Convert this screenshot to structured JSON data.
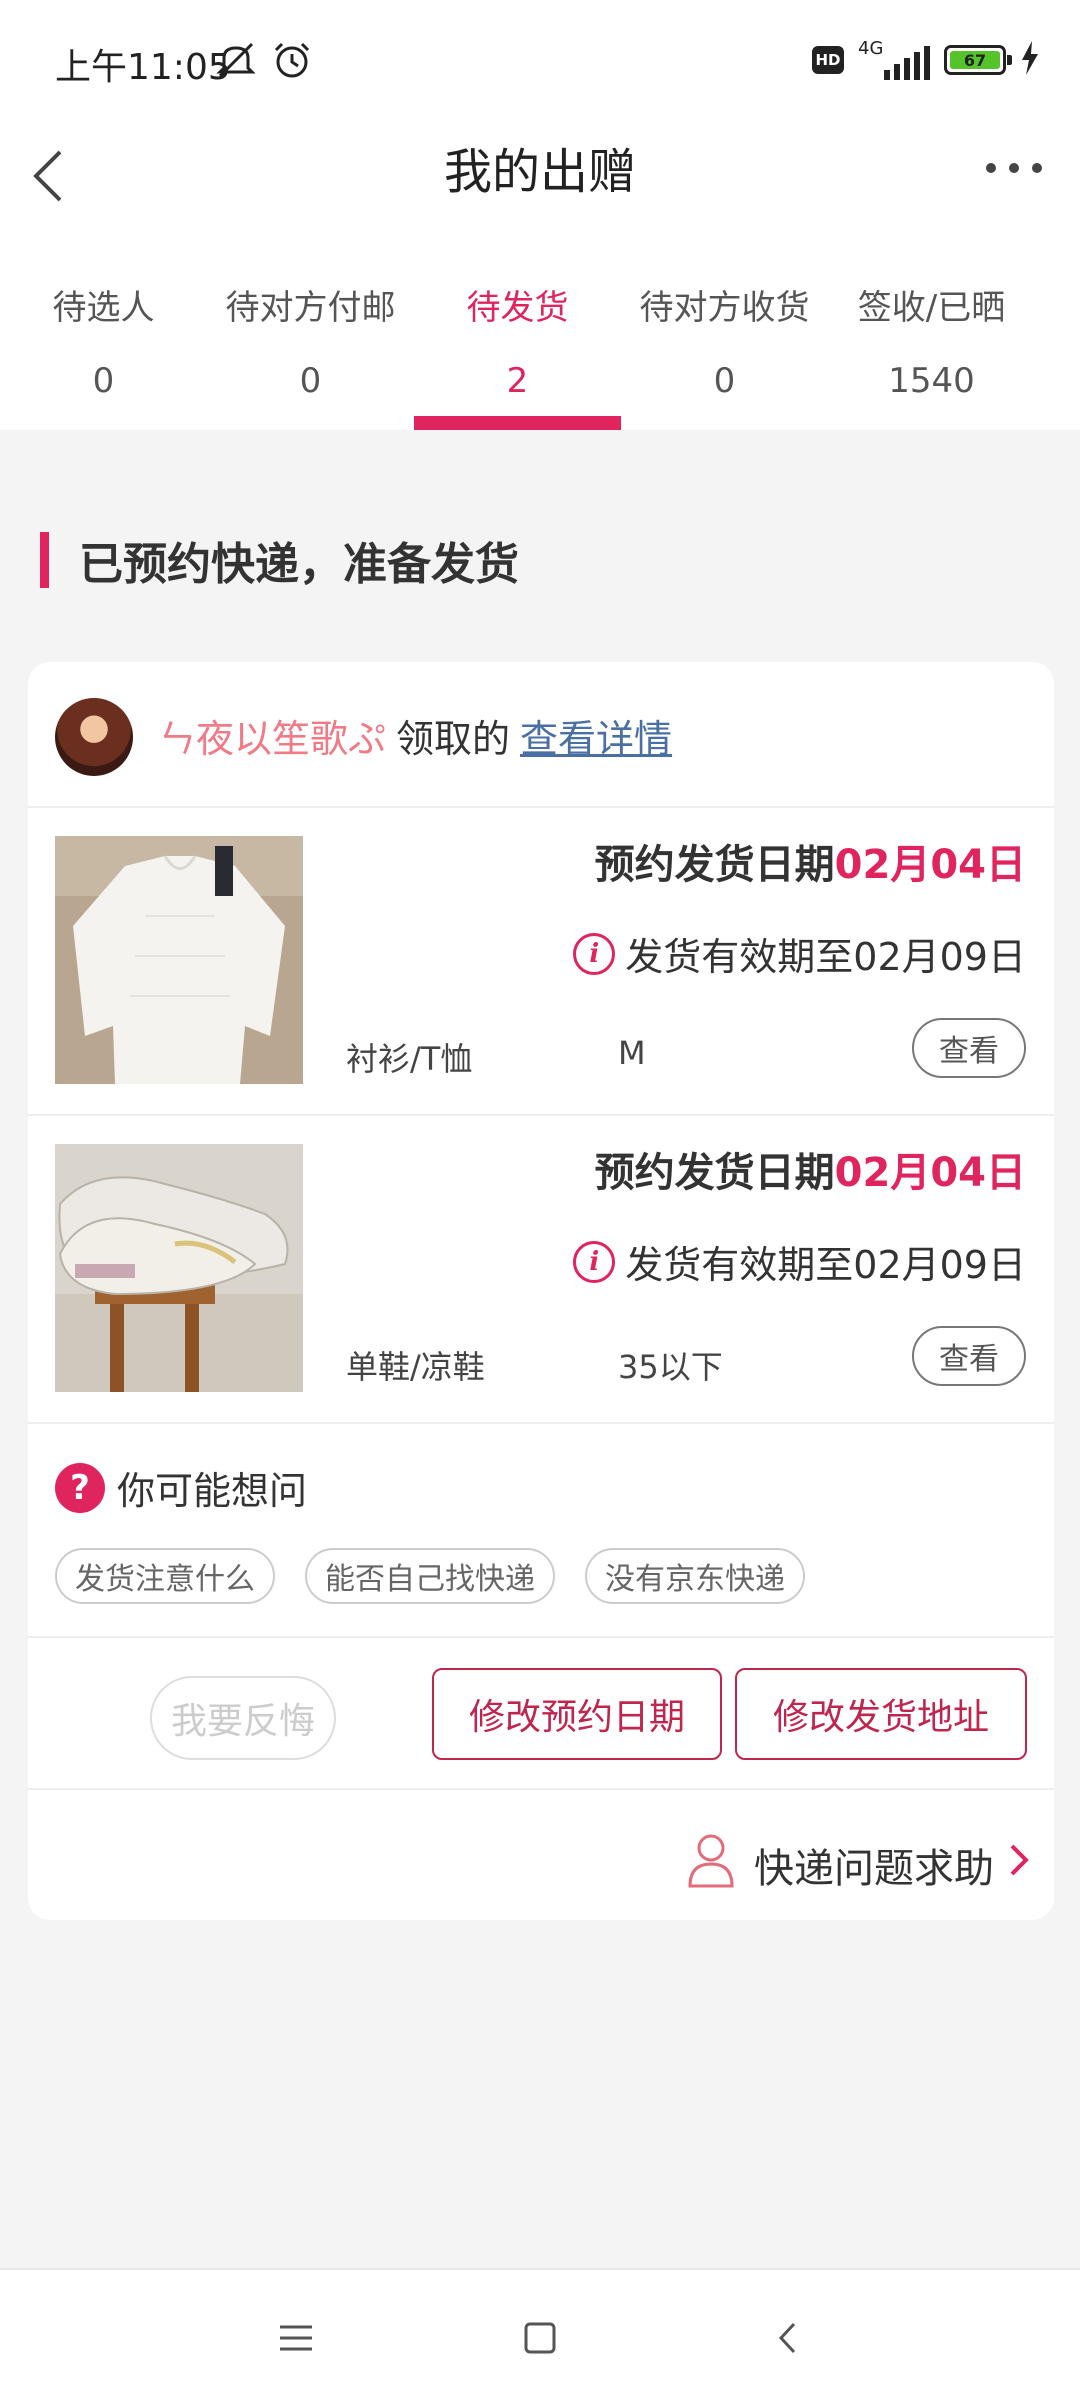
{
  "status_bar": {
    "time": "上午11:05",
    "hd_label": "HD",
    "network_label": "4G",
    "battery_level": "67",
    "icons": [
      "mute-icon",
      "alarm-icon",
      "signal-icon",
      "battery-icon",
      "charging-icon"
    ]
  },
  "header": {
    "title": "我的出赠",
    "back_icon": "chevron-left-icon",
    "more_icon": "more-dots-icon"
  },
  "tabs": [
    {
      "label": "待选人",
      "count": "0"
    },
    {
      "label": "待对方付邮",
      "count": "0"
    },
    {
      "label": "待发货",
      "count": "2"
    },
    {
      "label": "待对方收货",
      "count": "0"
    },
    {
      "label": "签收/已晒",
      "count": "1540"
    }
  ],
  "active_tab": 2,
  "section_title": "已预约快递，准备发货",
  "card": {
    "recipient_nickname": "ㄣ夜以笙歌ぷ",
    "claim_text": "领取的",
    "detail_link": "查看详情",
    "items": [
      {
        "ship_label": "预约发货日期",
        "ship_date": "02月04日",
        "valid_text": "发货有效期至02月09日",
        "category": "衬衫/T恤",
        "size": "M",
        "view_label": "查看"
      },
      {
        "ship_label": "预约发货日期",
        "ship_date": "02月04日",
        "valid_text": "发货有效期至02月09日",
        "category": "单鞋/凉鞋",
        "size": "35以下",
        "view_label": "查看"
      }
    ],
    "faq": {
      "title": "你可能想问",
      "chips": [
        "发货注意什么",
        "能否自己找快递",
        "没有京东快递"
      ]
    },
    "actions": {
      "regret": "我要反悔",
      "change_date": "修改预约日期",
      "change_address": "修改发货地址"
    },
    "help_text": "快递问题求助"
  },
  "colors": {
    "accent": "#e0245e",
    "button_border": "#c0264d",
    "link": "#4a6fa5",
    "nickname": "#f07a86"
  }
}
